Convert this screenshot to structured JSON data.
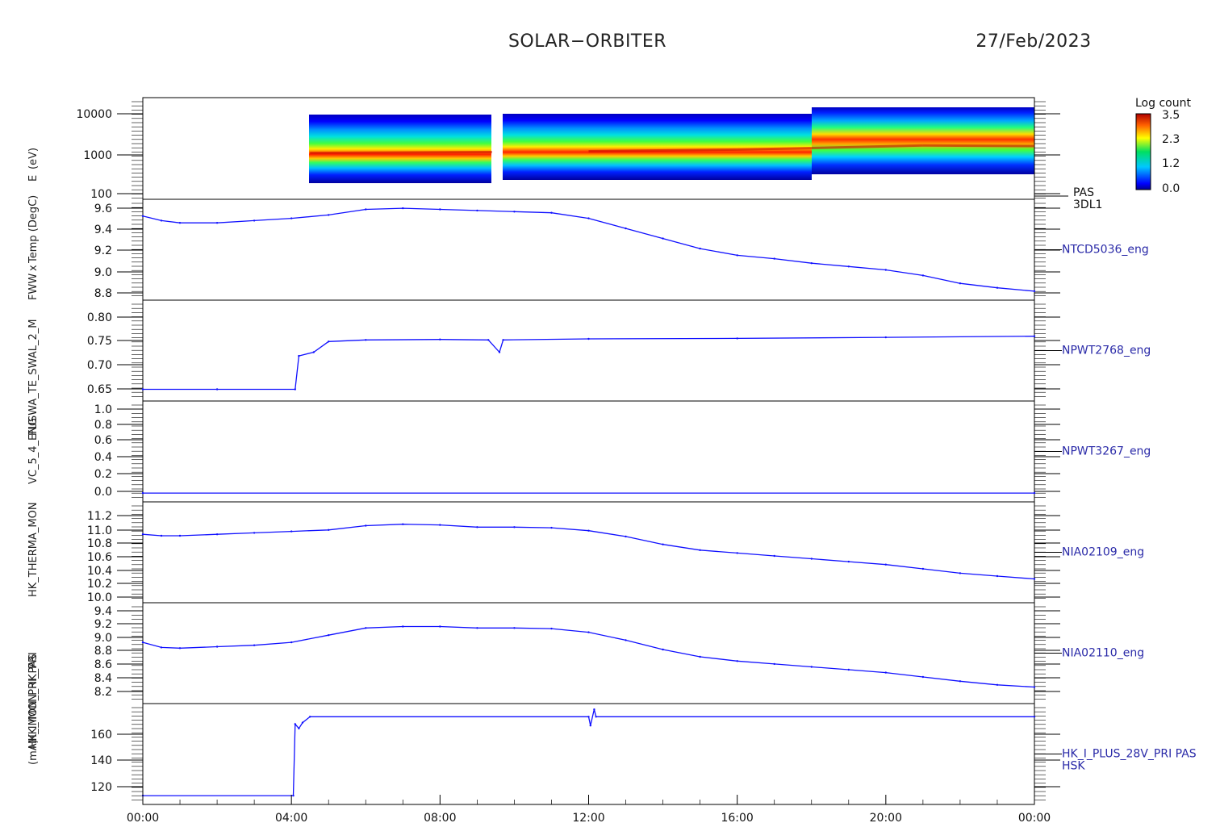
{
  "title": "SOLAR−ORBITER",
  "date": "27/Feb/2023",
  "colorbar": {
    "label": "Log count",
    "ticks": [
      "3.5",
      "2.3",
      "1.2",
      "0.0"
    ],
    "range": [
      0.0,
      3.5
    ]
  },
  "left_labels": [
    "(eV)",
    "E",
    "Temp (DegC)",
    "x",
    "FWW",
    "FUSWA_TE_SWAL_2_M",
    "VC_5_4_ENG",
    "HK_THERMA_MON",
    "HK_IMON_HK_PRI",
    "HK_IMON_PRI_PAS",
    "(mA)"
  ],
  "chart_data": [
    {
      "type": "heatmap",
      "name": "PAS 3DL1",
      "right_label": [
        "PAS",
        "3DL1"
      ],
      "yscale": "log",
      "ylim": [
        100,
        15000
      ],
      "ytick_labels": [
        "10000",
        "1000",
        "100"
      ],
      "peak_energy_ev": [
        [
          4.5,
          950
        ],
        [
          9.4,
          1000
        ],
        [
          9.6,
          980
        ],
        [
          12,
          1050
        ],
        [
          16,
          1150
        ],
        [
          18,
          1250
        ],
        [
          21,
          1450
        ],
        [
          24,
          1400
        ]
      ],
      "data_gaps_hours": [
        [
          0,
          4.3
        ],
        [
          9.4,
          9.8
        ]
      ]
    },
    {
      "type": "line",
      "name": "NTCD5036_eng",
      "right_label": [
        "NTCD5036_eng"
      ],
      "ylim": [
        8.75,
        9.65
      ],
      "ytick_labels": [
        "9.6",
        "9.4",
        "9.2",
        "9.0",
        "8.8"
      ],
      "x": [
        0,
        0.5,
        1,
        2,
        3,
        4,
        5,
        6,
        7,
        8,
        9,
        10,
        11,
        12,
        13,
        14,
        15,
        16,
        17,
        18,
        19,
        20,
        21,
        22,
        23,
        24
      ],
      "y": [
        9.5,
        9.46,
        9.44,
        9.44,
        9.46,
        9.48,
        9.51,
        9.56,
        9.57,
        9.56,
        9.55,
        9.54,
        9.53,
        9.48,
        9.39,
        9.3,
        9.21,
        9.15,
        9.12,
        9.08,
        9.05,
        9.02,
        8.97,
        8.9,
        8.86,
        8.83
      ]
    },
    {
      "type": "line",
      "name": "NPWT2768_eng",
      "right_label": [
        "NPWT2768_eng"
      ],
      "ylim": [
        0.63,
        0.82
      ],
      "ytick_labels": [
        "0.80",
        "0.75",
        "0.70",
        "0.65"
      ],
      "x": [
        0,
        2,
        4.1,
        4.2,
        4.6,
        5,
        6,
        8,
        9.3,
        9.6,
        9.7,
        12,
        16,
        20,
        24
      ],
      "y": [
        0.652,
        0.652,
        0.652,
        0.715,
        0.722,
        0.742,
        0.745,
        0.746,
        0.745,
        0.722,
        0.745,
        0.747,
        0.748,
        0.75,
        0.752
      ]
    },
    {
      "type": "line",
      "name": "NPWT3267_eng",
      "right_label": [
        "NPWT3267_eng"
      ],
      "ylim": [
        -0.1,
        1.05
      ],
      "ytick_labels": [
        "1.0",
        "0.8",
        "0.6",
        "0.4",
        "0.2",
        "0.0"
      ],
      "x": [
        0,
        24
      ],
      "y": [
        0.0,
        0.0
      ]
    },
    {
      "type": "line",
      "name": "NIA02109_eng",
      "right_label": [
        "NIA02109_eng"
      ],
      "ylim": [
        9.95,
        11.35
      ],
      "ytick_labels": [
        "11.2",
        "11.0",
        "10.8",
        "10.6",
        "10.4",
        "10.2",
        "10.0"
      ],
      "x": [
        0,
        0.5,
        1,
        2,
        3,
        4,
        5,
        6,
        7,
        8,
        9,
        10,
        11,
        12,
        13,
        14,
        15,
        16,
        17,
        18,
        19,
        20,
        21,
        22,
        23,
        24
      ],
      "y": [
        10.9,
        10.88,
        10.88,
        10.9,
        10.92,
        10.94,
        10.96,
        11.02,
        11.04,
        11.03,
        11.0,
        11.0,
        10.99,
        10.95,
        10.87,
        10.76,
        10.68,
        10.64,
        10.6,
        10.56,
        10.52,
        10.48,
        10.42,
        10.36,
        10.32,
        10.28
      ]
    },
    {
      "type": "line",
      "name": "NIA02110_eng",
      "right_label": [
        "NIA02110_eng"
      ],
      "ylim": [
        8.05,
        9.45
      ],
      "ytick_labels": [
        "9.4",
        "9.2",
        "9.0",
        "8.8",
        "8.6",
        "8.4",
        "8.2"
      ],
      "x": [
        0,
        0.5,
        1,
        2,
        3,
        4,
        5,
        6,
        7,
        8,
        9,
        10,
        11,
        12,
        13,
        14,
        15,
        16,
        17,
        18,
        19,
        20,
        21,
        22,
        23,
        24
      ],
      "y": [
        8.9,
        8.83,
        8.82,
        8.84,
        8.86,
        8.9,
        9.0,
        9.1,
        9.12,
        9.12,
        9.1,
        9.1,
        9.09,
        9.04,
        8.93,
        8.8,
        8.7,
        8.64,
        8.6,
        8.56,
        8.52,
        8.48,
        8.42,
        8.36,
        8.31,
        8.28
      ]
    },
    {
      "type": "line",
      "name": "HK_I_PLUS_28V_PRI PAS HSK",
      "right_label": [
        "HK_I_PLUS_28V_PRI PAS",
        "HSK"
      ],
      "ylim": [
        108,
        177
      ],
      "ytick_labels": [
        "160",
        "140",
        "120"
      ],
      "x": [
        0,
        4.05,
        4.1,
        4.2,
        4.3,
        4.5,
        12.0,
        12.05,
        12.15,
        12.2,
        24
      ],
      "y": [
        114,
        114,
        163,
        160,
        164,
        168,
        168,
        162,
        173,
        168,
        168
      ]
    }
  ],
  "x_axis": {
    "range_hours": [
      0,
      24
    ],
    "tick_labels": [
      "00:00",
      "04:00",
      "08:00",
      "12:00",
      "16:00",
      "20:00",
      "00:00"
    ]
  }
}
